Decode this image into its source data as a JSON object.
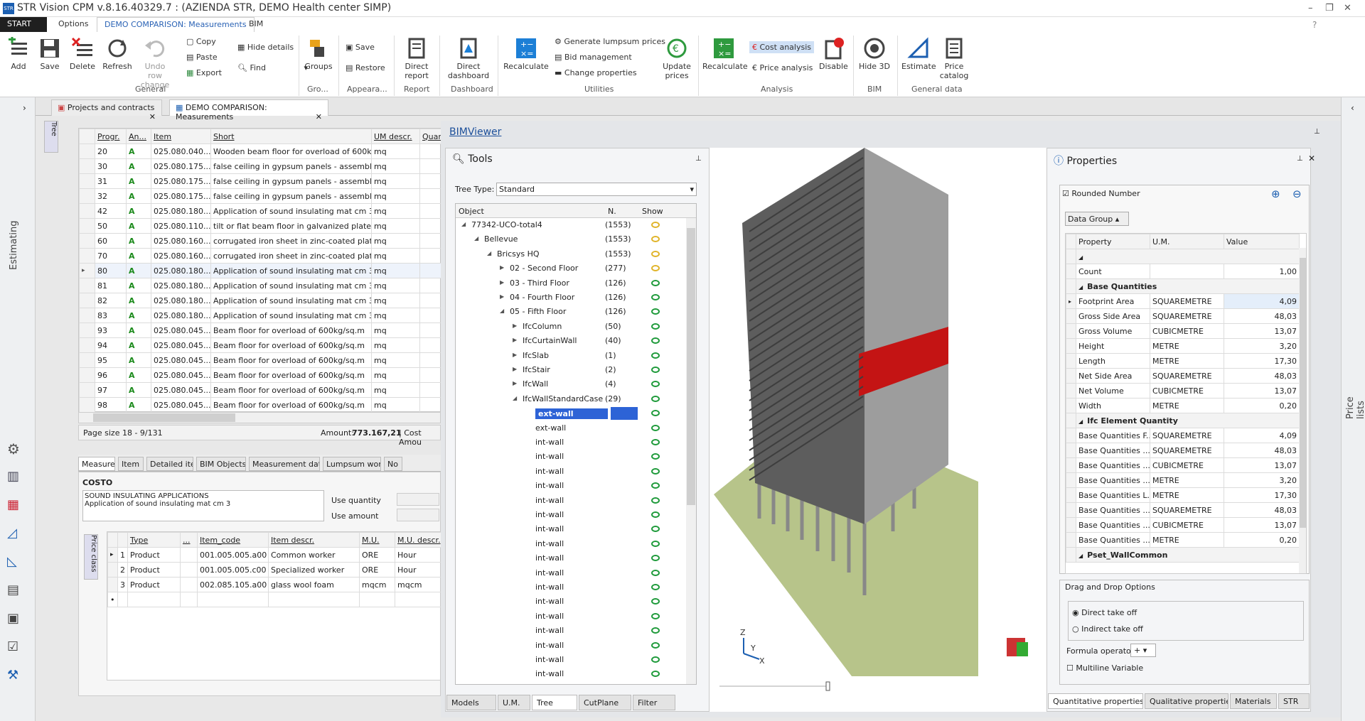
{
  "app": {
    "title": "STR Vision CPM v.8.16.40329.7 : (AZIENDA STR, DEMO Health center SIMP)",
    "logo": "STR"
  },
  "menu_tabs": [
    "START",
    "Options",
    "DEMO COMPARISON: Measurements",
    "BIM"
  ],
  "ribbon": {
    "general": {
      "label": "General",
      "add": "Add",
      "save": "Save",
      "delete": "Delete",
      "refresh": "Refresh",
      "undo": "Undo row change",
      "copy": "Copy",
      "paste": "Paste",
      "export": "Export",
      "hide_details": "Hide details",
      "find": "Find"
    },
    "groups": {
      "label": "Gro...",
      "btn": "Groups"
    },
    "appearance": {
      "label": "Appeara...",
      "save": "Save",
      "restore": "Restore"
    },
    "report": {
      "label": "Report",
      "btn": "Direct report"
    },
    "dashboard": {
      "label": "Dashboard",
      "btn": "Direct dashboard"
    },
    "utilities": {
      "label": "Utilities",
      "recalculate": "Recalculate",
      "gen": "Generate lumpsum prices",
      "bid": "Bid management",
      "change": "Change properties",
      "update": "Update prices"
    },
    "analysis": {
      "label": "Analysis",
      "recalculate": "Recalculate",
      "cost": "Cost analysis",
      "price": "Price analysis",
      "disable": "Disable"
    },
    "bim": {
      "label": "BIM",
      "hide3d": "Hide 3D"
    },
    "gendata": {
      "label": "General data",
      "estimate": "Estimate",
      "catalog": "Price catalog"
    }
  },
  "rail": {
    "estimating": "Estimating",
    "tree": "Tree",
    "price_class": "Price class",
    "price_lists": "Price lists"
  },
  "doc_tabs": [
    "Projects and contracts",
    "DEMO COMPARISON: Measurements"
  ],
  "grid": {
    "headers": [
      "Progr.",
      "An...",
      "Item",
      "Short",
      "UM descr.",
      "Quar"
    ],
    "rows": [
      [
        "20",
        "A",
        "025.080.040....",
        "Wooden beam floor for overload of 600kg/...",
        "mq"
      ],
      [
        "30",
        "A",
        "025.080.175....",
        "false ceiling in gypsum panels - assembled ...",
        "mq"
      ],
      [
        "31",
        "A",
        "025.080.175....",
        "false ceiling in gypsum panels - assembled ...",
        "mq"
      ],
      [
        "32",
        "A",
        "025.080.175....",
        "false ceiling in gypsum panels - assembled ...",
        "mq"
      ],
      [
        "42",
        "A",
        "025.080.180....",
        "Application of  sound insulating  mat cm 3",
        "mq"
      ],
      [
        "50",
        "A",
        "025.080.110....",
        "tilt or flat beam floor in galvanized plate, h ...",
        "mq"
      ],
      [
        "60",
        "A",
        "025.080.160....",
        "corrugated iron sheet in zinc-coated plate ...",
        "mq"
      ],
      [
        "70",
        "A",
        "025.080.160....",
        "corrugated iron sheet in zinc-coated plate ...",
        "mq"
      ],
      [
        "80",
        "A",
        "025.080.180....",
        "Application of  sound insulating  mat cm 3",
        "mq"
      ],
      [
        "81",
        "A",
        "025.080.180....",
        "Application of  sound insulating  mat cm 3",
        "mq"
      ],
      [
        "82",
        "A",
        "025.080.180....",
        "Application of  sound insulating  mat cm 3",
        "mq"
      ],
      [
        "83",
        "A",
        "025.080.180....",
        "Application of  sound insulating  mat cm 3",
        "mq"
      ],
      [
        "93",
        "A",
        "025.080.045....",
        "Beam floor for overload of 600kg/sq.m",
        "mq"
      ],
      [
        "94",
        "A",
        "025.080.045....",
        "Beam floor for overload of 600kg/sq.m",
        "mq"
      ],
      [
        "95",
        "A",
        "025.080.045....",
        "Beam floor for overload of 600kg/sq.m",
        "mq"
      ],
      [
        "96",
        "A",
        "025.080.045....",
        "Beam floor for overload of 600kg/sq.m",
        "mq"
      ],
      [
        "97",
        "A",
        "025.080.045....",
        "Beam floor for overload of 600kg/sq.m",
        "mq"
      ],
      [
        "98",
        "A",
        "025.080.045....",
        "Beam floor for overload of 600kg/sq.m",
        "mq"
      ]
    ],
    "page_size": "Page size  18  - 9/131",
    "amount_label": "Amount:",
    "amount": "773.167,21",
    "cost_amount": "| Cost Amou"
  },
  "detail_tabs": [
    "Measures",
    "Item",
    "Detailed item",
    "BIM Objects",
    "Measurement data",
    "Lumpsum works",
    "No"
  ],
  "costo": {
    "label": "COSTO",
    "line1": "SOUND INSULATING APPLICATIONS",
    "line2": "Application of  sound insulating  mat cm 3",
    "use_quantity": "Use quantity",
    "use_amount": "Use amount"
  },
  "price_table": {
    "headers": [
      "Type",
      "...",
      "Item_code",
      "Item descr.",
      "M.U.",
      "M.U. descr."
    ],
    "rows": [
      [
        "1",
        "Product",
        "001.005.005.a00",
        "Common worker",
        "ORE",
        "Hour"
      ],
      [
        "2",
        "Product",
        "001.005.005.c00",
        "Specialized worker",
        "ORE",
        "Hour"
      ],
      [
        "3",
        "Product",
        "002.085.105.a00",
        "glass wool foam",
        "mqcm",
        "mqcm"
      ]
    ]
  },
  "bim": {
    "title": "BIMViewer",
    "tools_title": "Tools",
    "tree_type_label": "Tree Type:",
    "tree_type": "Standard",
    "tree_headers": [
      "Object",
      "N.",
      "Show"
    ],
    "tree": [
      [
        "77342-UCO-total4",
        "(1553)",
        0,
        "y"
      ],
      [
        "Bellevue",
        "(1553)",
        1,
        "y"
      ],
      [
        "Bricsys HQ",
        "(1553)",
        2,
        "y"
      ],
      [
        "02 - Second Floor",
        "(277)",
        3,
        "y"
      ],
      [
        "03 - Third Floor",
        "(126)",
        3,
        "g"
      ],
      [
        "04 - Fourth Floor",
        "(126)",
        3,
        "g"
      ],
      [
        "05 - Fifth Floor",
        "(126)",
        3,
        "g"
      ],
      [
        "IfcColumn",
        "(50)",
        4,
        "g"
      ],
      [
        "IfcCurtainWall",
        "(40)",
        4,
        "g"
      ],
      [
        "IfcSlab",
        "(1)",
        4,
        "g"
      ],
      [
        "IfcStair",
        "(2)",
        4,
        "g"
      ],
      [
        "IfcWall",
        "(4)",
        4,
        "g"
      ],
      [
        "IfcWallStandardCase",
        "(29)",
        4,
        "g"
      ],
      [
        "ext-wall",
        "",
        5,
        "g"
      ],
      [
        "ext-wall",
        "",
        5,
        "g"
      ],
      [
        "int-wall",
        "",
        5,
        "g"
      ],
      [
        "int-wall",
        "",
        5,
        "g"
      ],
      [
        "int-wall",
        "",
        5,
        "g"
      ],
      [
        "int-wall",
        "",
        5,
        "g"
      ],
      [
        "int-wall",
        "",
        5,
        "g"
      ],
      [
        "int-wall",
        "",
        5,
        "g"
      ],
      [
        "int-wall",
        "",
        5,
        "g"
      ],
      [
        "int-wall",
        "",
        5,
        "g"
      ],
      [
        "int-wall",
        "",
        5,
        "g"
      ],
      [
        "int-wall",
        "",
        5,
        "g"
      ],
      [
        "int-wall",
        "",
        5,
        "g"
      ],
      [
        "int-wall",
        "",
        5,
        "g"
      ],
      [
        "int-wall",
        "",
        5,
        "g"
      ],
      [
        "int-wall",
        "",
        5,
        "g"
      ],
      [
        "int-wall",
        "",
        5,
        "g"
      ],
      [
        "int-wall",
        "",
        5,
        "g"
      ],
      [
        "int-wall",
        "",
        5,
        "g"
      ],
      [
        "int-wall",
        "",
        5,
        "g"
      ]
    ],
    "tool_tabs": [
      "Models",
      "U.M.",
      "Tree",
      "CutPlane",
      "Filter"
    ],
    "axis": {
      "z": "Z",
      "y": "Y",
      "x": "X"
    }
  },
  "props": {
    "title": "Properties",
    "rounded": "Rounded Number",
    "data_group": "Data Group",
    "headers": [
      "Property",
      "U.M.",
      "Value"
    ],
    "rows": [
      [
        "",
        "",
        "",
        "h0"
      ],
      [
        "Count",
        "",
        "1,00",
        "r"
      ],
      [
        "Base Quantities",
        "",
        "",
        "h1"
      ],
      [
        "Footprint Area",
        "SQUAREMETRE",
        "4,09",
        "s"
      ],
      [
        "Gross Side Area",
        "SQUAREMETRE",
        "48,03",
        "r"
      ],
      [
        "Gross Volume",
        "CUBICMETRE",
        "13,07",
        "r"
      ],
      [
        "Height",
        "METRE",
        "3,20",
        "r"
      ],
      [
        "Length",
        "METRE",
        "17,30",
        "r"
      ],
      [
        "Net Side Area",
        "SQUAREMETRE",
        "48,03",
        "r"
      ],
      [
        "Net Volume",
        "CUBICMETRE",
        "13,07",
        "r"
      ],
      [
        "Width",
        "METRE",
        "0,20",
        "r"
      ],
      [
        "Ifc Element Quantity",
        "",
        "",
        "h1"
      ],
      [
        "Base Quantities F...",
        "SQUAREMETRE",
        "4,09",
        "r"
      ],
      [
        "Base Quantities ...",
        "SQUAREMETRE",
        "48,03",
        "r"
      ],
      [
        "Base Quantities ...",
        "CUBICMETRE",
        "13,07",
        "r"
      ],
      [
        "Base Quantities ...",
        "METRE",
        "3,20",
        "r"
      ],
      [
        "Base Quantities L...",
        "METRE",
        "17,30",
        "r"
      ],
      [
        "Base Quantities ...",
        "SQUAREMETRE",
        "48,03",
        "r"
      ],
      [
        "Base Quantities ...",
        "CUBICMETRE",
        "13,07",
        "r"
      ],
      [
        "Base Quantities ...",
        "METRE",
        "0,20",
        "r"
      ],
      [
        "Pset_WallCommon",
        "",
        "",
        "h1"
      ]
    ],
    "dd_title": "Drag and Drop Options",
    "direct": "Direct take off",
    "indirect": "Indirect take off",
    "formula": "Formula operator:",
    "formula_val": "+",
    "multiline": "Multiline Variable",
    "tabs": [
      "Quantitative properties",
      "Qualitative properties",
      "Materials",
      "STR"
    ]
  }
}
